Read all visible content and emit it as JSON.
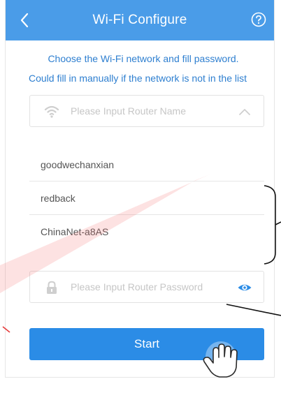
{
  "header": {
    "title": "Wi-Fi Configure",
    "back_icon": "chevron-left-icon",
    "help_icon": "question-circle-icon",
    "bg_color": "#4a9ce8"
  },
  "instructions": {
    "line1": "Choose the Wi-Fi network and fill password.",
    "line2": "Could fill in manually if the network is not in the list"
  },
  "router_field": {
    "placeholder": "Please Input Router Name",
    "icon": "wifi-icon",
    "toggle_icon": "chevron-up-icon"
  },
  "networks": [
    {
      "name": "goodwechanxian"
    },
    {
      "name": "redback"
    },
    {
      "name": "ChinaNet-a8AS"
    }
  ],
  "password_field": {
    "placeholder": "Please Input Router Password",
    "icon": "lock-icon",
    "toggle_icon": "eye-icon"
  },
  "start_button": {
    "label": "Start",
    "color": "#2b8ce6"
  },
  "annotations": {
    "pointer_icon": "hand-pointer-icon",
    "bracket_icon": "bracket-icon"
  }
}
